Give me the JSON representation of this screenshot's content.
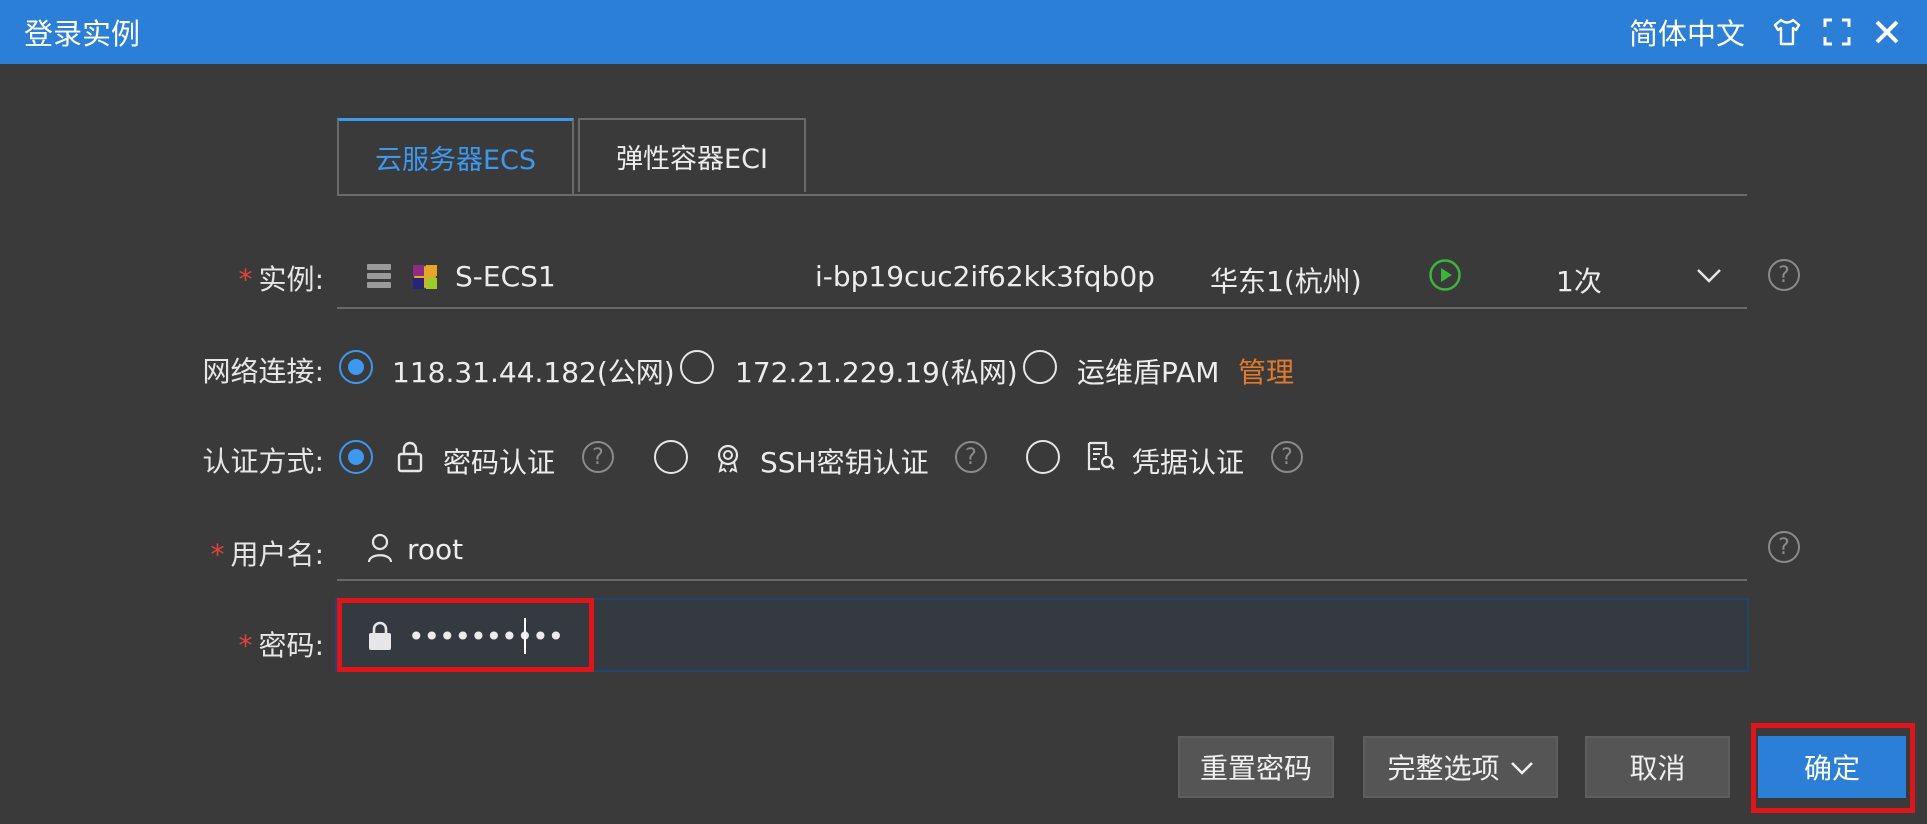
{
  "window": {
    "title": "登录实例",
    "language": "简体中文",
    "icons": [
      "shirt-icon",
      "fullscreen-icon",
      "close-icon"
    ]
  },
  "tabs": [
    {
      "label": "云服务器ECS",
      "active": true
    },
    {
      "label": "弹性容器ECI",
      "active": false
    }
  ],
  "form": {
    "instance": {
      "label": "实例",
      "name": "S-ECS1",
      "id": "i-bp19cuc2if62kk3fqb0p",
      "region": "华东1(杭州)",
      "count": "1次",
      "status_icon": "running-play-icon"
    },
    "network": {
      "label": "网络连接",
      "options": [
        {
          "label": "118.31.44.182(公网)",
          "selected": true
        },
        {
          "label": "172.21.229.19(私网)",
          "selected": false
        },
        {
          "label": "运维盾PAM",
          "selected": false
        }
      ],
      "manage_link": "管理"
    },
    "auth": {
      "label": "认证方式",
      "options": [
        {
          "label": "密码认证",
          "icon": "lock-icon",
          "selected": true
        },
        {
          "label": "SSH密钥认证",
          "icon": "key-badge-icon",
          "selected": false
        },
        {
          "label": "凭据认证",
          "icon": "credential-doc-icon",
          "selected": false
        }
      ]
    },
    "username": {
      "label": "用户名",
      "value": "root"
    },
    "password": {
      "label": "密码",
      "masked_value": "••••••••••"
    }
  },
  "buttons": {
    "reset_password": "重置密码",
    "full_options": "完整选项",
    "cancel": "取消",
    "confirm": "确定"
  },
  "colors": {
    "accent": "#2b7fd6",
    "tab_active": "#3d98ee",
    "required": "#e0453b",
    "link": "#e07b2e",
    "highlight": "#e0151b",
    "running": "#3bb53b"
  },
  "label_colon": ":",
  "required_mark": "*",
  "help_mark": "?"
}
